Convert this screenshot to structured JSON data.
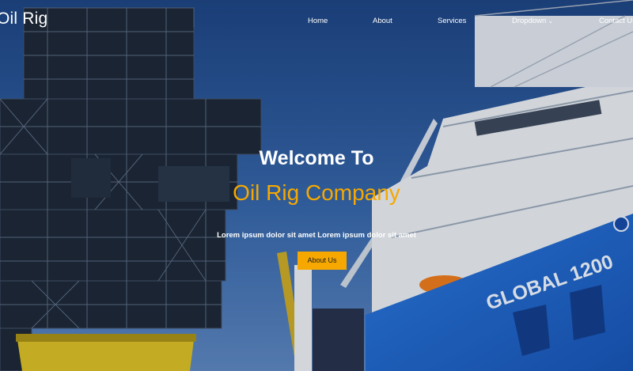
{
  "brand": {
    "name": "Oil Rig"
  },
  "nav": {
    "items": [
      {
        "label": "Home"
      },
      {
        "label": "About"
      },
      {
        "label": "Services"
      },
      {
        "label": "Dropdown",
        "caret": "chevron-down-icon"
      },
      {
        "label": "Contact Us"
      }
    ]
  },
  "hero": {
    "heading": "Welcome To",
    "subheading": "Oil Rig Company",
    "lead": "Lorem ipsum dolor sit amet Lorem ipsum dolor sit amet",
    "cta_label": "About Us",
    "ship_lettering": "GLOBAL 1200"
  },
  "colors": {
    "accent": "#f6a800",
    "sky": "#2a5597",
    "hull": "#1f63c8",
    "rig": "#1b2735"
  }
}
